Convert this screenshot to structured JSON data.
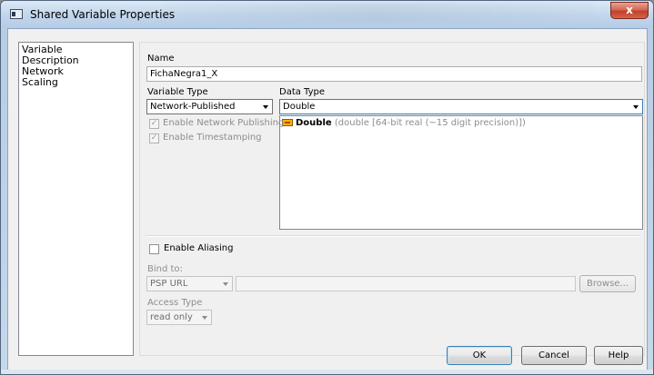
{
  "window": {
    "title": "Shared Variable Properties",
    "close_label": "x"
  },
  "categories": [
    "Variable",
    "Description",
    "Network",
    "Scaling"
  ],
  "name_section": {
    "label": "Name",
    "value": "FichaNegra1_X"
  },
  "variable_type": {
    "label": "Variable Type",
    "selected": "Network-Published"
  },
  "data_type": {
    "label": "Data Type",
    "selected": "Double",
    "list_item_name": "Double",
    "list_item_desc": "(double [64-bit real (~15 digit precision)])"
  },
  "options": {
    "enable_network_publishing": {
      "label": "Enable Network Publishing",
      "checked": true,
      "enabled": false
    },
    "enable_timestamping": {
      "label": "Enable Timestamping",
      "checked": true,
      "enabled": false
    },
    "enable_aliasing": {
      "label": "Enable Aliasing",
      "checked": false,
      "enabled": true
    }
  },
  "bind_to": {
    "label": "Bind to:",
    "selected": "PSP URL",
    "url_value": "",
    "browse_label": "Browse..."
  },
  "access_type": {
    "label": "Access Type",
    "selected": "read only"
  },
  "buttons": {
    "ok": "OK",
    "cancel": "Cancel",
    "help": "Help"
  },
  "glyphs": {
    "check": "✓"
  }
}
